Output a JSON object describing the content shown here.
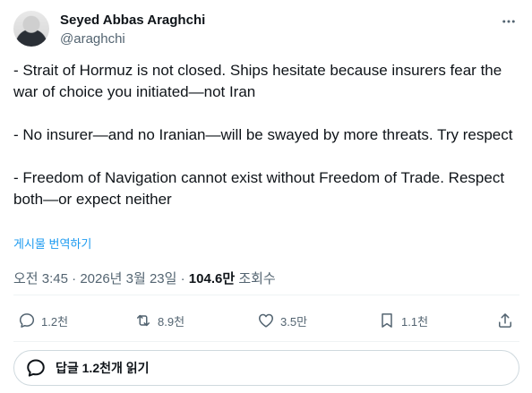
{
  "author": {
    "name": "Seyed Abbas Araghchi",
    "handle": "@araghchi"
  },
  "tweet": {
    "paragraphs": [
      "- Strait of Hormuz is not closed. Ships hesitate because insurers fear the war of choice you initiated—not Iran",
      "- No insurer—and no Iranian—will be swayed by more threats. Try respect",
      "- Freedom of Navigation cannot exist without Freedom of Trade. Respect both—or expect neither"
    ],
    "translate_label": "게시물 번역하기"
  },
  "meta": {
    "time": "오전 3:45",
    "separator": "·",
    "date": "2026년 3월 23일",
    "views_count": "104.6만",
    "views_label": "조회수"
  },
  "actions": {
    "replies": "1.2천",
    "retweets": "8.9천",
    "likes": "3.5만",
    "bookmarks": "1.1천"
  },
  "reply_box": {
    "label": "답글 1.2천개 읽기"
  }
}
